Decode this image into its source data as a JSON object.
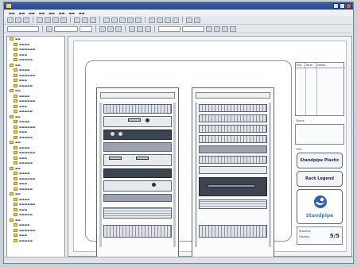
{
  "window": {
    "title": ""
  },
  "tree": {
    "item_count": 40
  },
  "panel": {
    "grid_headers": [
      "Rev",
      "Item",
      "Notes"
    ],
    "field_labels": [
      "Specs",
      "Title",
      "Logo"
    ],
    "stencil_button_label": "Standpipe Plastic",
    "legend_button_label": "Rack Legend",
    "logo_text": "Standpipe",
    "legend_rows": [
      "Standby",
      "Display"
    ],
    "legend_value": "5/5"
  },
  "colors": {
    "title_bar": "#2f509a",
    "canvas": "#ffffff",
    "logo_blue": "#3f77c9"
  }
}
